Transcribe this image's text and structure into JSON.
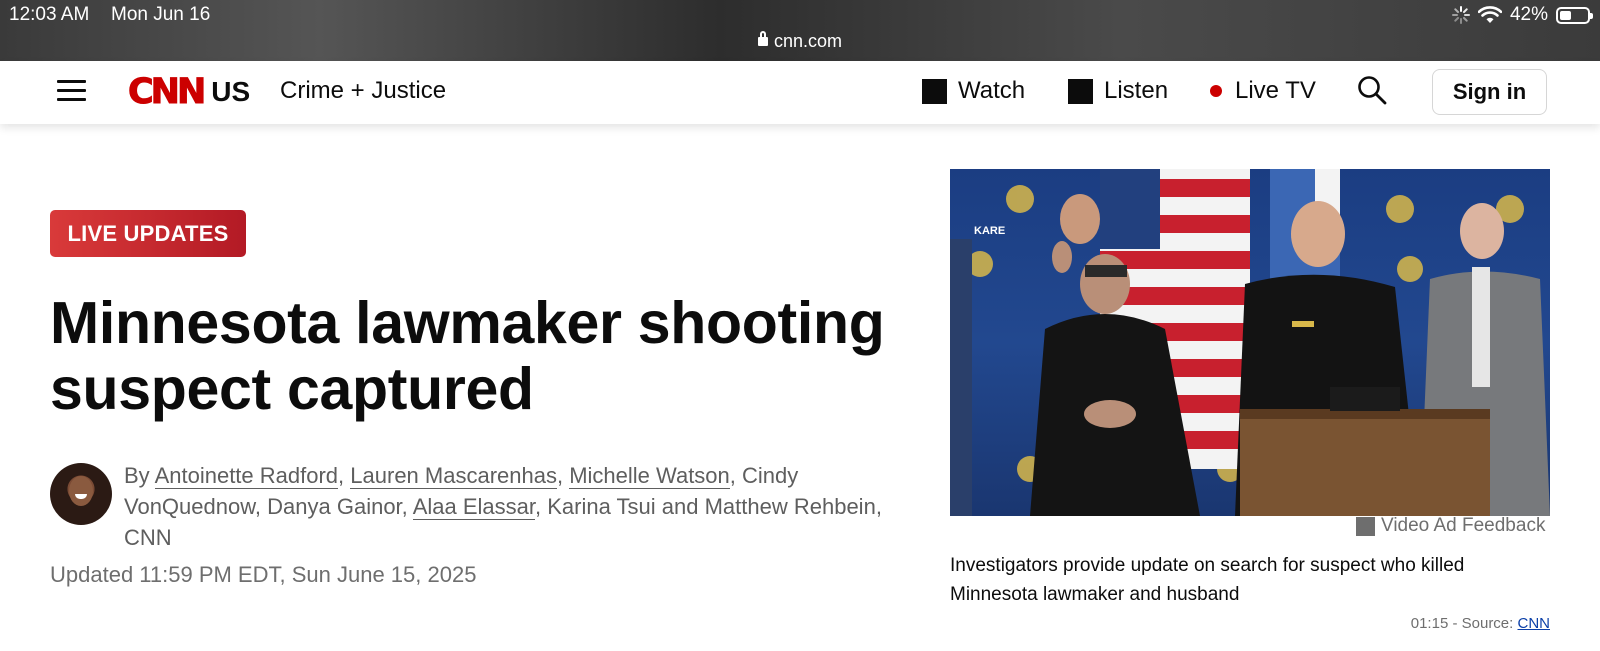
{
  "status_bar": {
    "time": "12:03 AM",
    "date": "Mon Jun 16",
    "url": "cnn.com",
    "battery_percent": "42%",
    "battery_level": 0.42,
    "icons": [
      "activity-spinner-icon",
      "wifi-icon",
      "battery-icon",
      "lock-icon"
    ]
  },
  "nav": {
    "logo_text": "CNN",
    "edition": "US",
    "section": "Crime + Justice",
    "watch": "Watch",
    "listen": "Listen",
    "live_tv": "Live TV",
    "sign_in": "Sign in"
  },
  "article": {
    "badge": "LIVE UPDATES",
    "headline": "Minnesota lawmaker shooting suspect captured",
    "byline_prefix": "By ",
    "authors": [
      {
        "name": "Antoinette Radford",
        "linked": true
      },
      {
        "name": "Lauren Mascarenhas",
        "linked": true
      },
      {
        "name": "Michelle Watson",
        "linked": true
      },
      {
        "name": "Cindy VonQuednow",
        "linked": false
      },
      {
        "name": "Danya Gainor",
        "linked": false
      },
      {
        "name": "Alaa Elassar",
        "linked": true
      },
      {
        "name": "Karina Tsui",
        "linked": false
      },
      {
        "name": "Matthew Rehbein",
        "linked": false
      }
    ],
    "sep_comma": ", ",
    "sep_and": " and ",
    "byline_suffix": ", CNN",
    "updated": "Updated 11:59 PM EDT, Sun June 15, 2025"
  },
  "video": {
    "overlay_text": "KARE",
    "ad_feedback": "Video Ad Feedback",
    "caption": "Investigators provide update on search for suspect who killed Minnesota lawmaker and husband",
    "duration": "01:15",
    "source_prefix": " - Source: ",
    "source": "CNN"
  },
  "colors": {
    "brand_red": "#cc0000",
    "badge_red": "#c1272d",
    "link_blue": "#0b3fa8"
  }
}
